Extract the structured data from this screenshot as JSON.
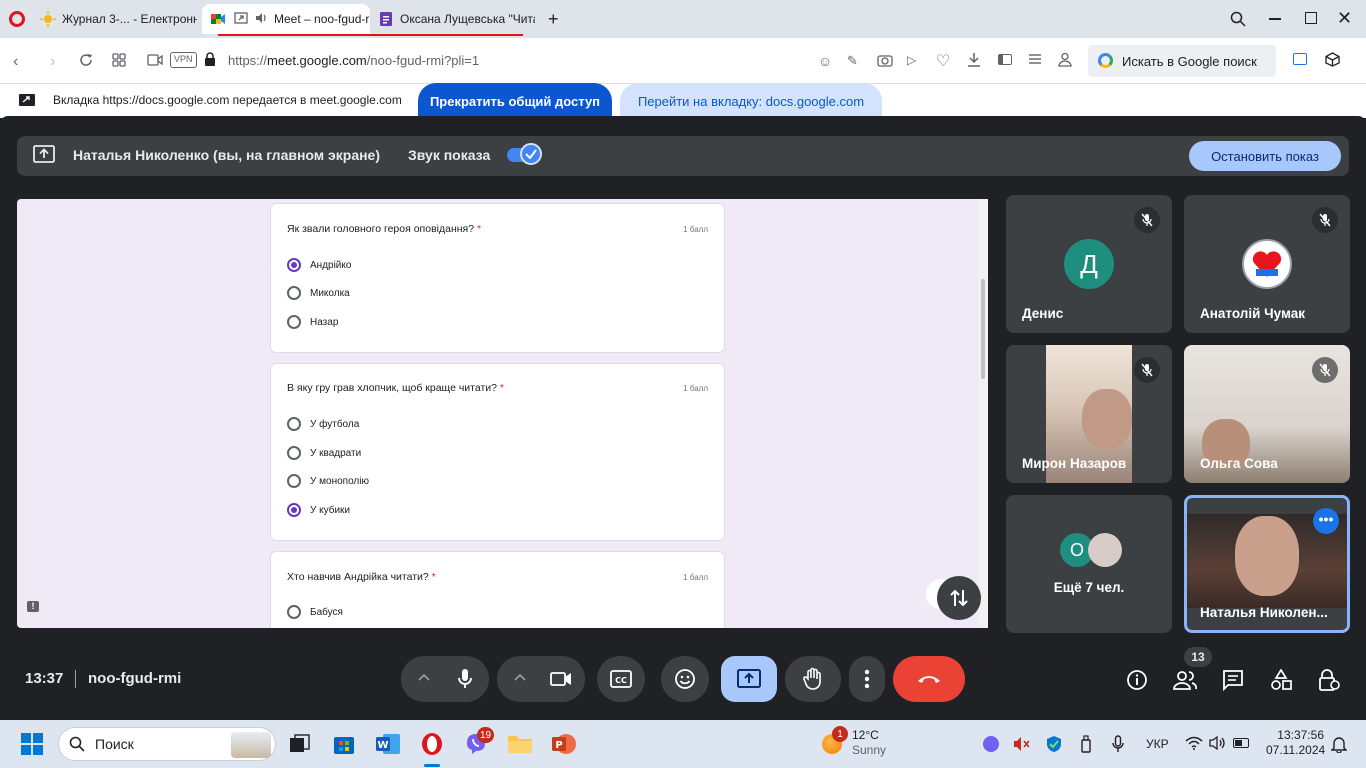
{
  "browser": {
    "tabs": [
      {
        "label": "Журнал 3-... - Електронні",
        "active": false
      },
      {
        "label": "Meet – noo-fgud-r",
        "active": true
      },
      {
        "label": "Оксана Лущевська \"Чита",
        "active": false
      }
    ],
    "url_prefix": "https://",
    "url_domain": "meet.google.com",
    "url_path": "/noo-fgud-rmi?pli=1",
    "vpn_label": "VPN",
    "search_placeholder": "Искать в Google поиск"
  },
  "share_notice": {
    "text": "Вкладка https://docs.google.com передается в meet.google.com",
    "stop_label": "Прекратить общий доступ",
    "goto_label": "Перейти на вкладку: docs.google.com"
  },
  "presenter": {
    "name": "Наталья Николенко (вы, на главном экране)",
    "sound_label": "Звук показа",
    "stop_label": "Остановить показ"
  },
  "form": {
    "questions": [
      {
        "title": "Як звали головного героя оповідання?",
        "required": "*",
        "points": "1 балл",
        "options": [
          {
            "label": "Андрійко",
            "selected": true
          },
          {
            "label": "Миколка",
            "selected": false
          },
          {
            "label": "Назар",
            "selected": false
          }
        ]
      },
      {
        "title": "В яку гру грав хлопчик, щоб краще читати?",
        "required": "*",
        "points": "1 балл",
        "options": [
          {
            "label": "У футбола",
            "selected": false
          },
          {
            "label": "У квадрати",
            "selected": false
          },
          {
            "label": "У монополію",
            "selected": false
          },
          {
            "label": "У кубики",
            "selected": true
          }
        ]
      },
      {
        "title": "Хто навчив Андрійка читати?",
        "required": "*",
        "points": "1 балл",
        "options": [
          {
            "label": "Бабуся",
            "selected": false
          }
        ]
      }
    ]
  },
  "participants": [
    {
      "name": "Денис",
      "initial": "Д",
      "avatar_color": "#1e8e7e",
      "muted": true
    },
    {
      "name": "Анатолій Чумак",
      "initial": "",
      "muted": true
    },
    {
      "name": "Мирон Назаров",
      "muted": true
    },
    {
      "name": "Ольга Сова",
      "muted": true
    },
    {
      "name": "Ещё 7 чел.",
      "initial": "О",
      "avatar_color": "#1e8e7e"
    },
    {
      "name": "Наталья Николен..."
    }
  ],
  "controls": {
    "time": "13:37",
    "meeting_code": "noo-fgud-rmi",
    "people_count": "13"
  },
  "taskbar": {
    "search_label": "Поиск",
    "viber_badge": "19",
    "weather_badge": "1",
    "temperature": "12°C",
    "weather_text": "Sunny",
    "language": "УКР",
    "time": "13:37:56",
    "date": "07.11.2024"
  },
  "colors": {
    "meet_bg": "#202124",
    "tile_bg": "#3c4043",
    "accent_blue": "#0b57d0",
    "end_call_red": "#ea4335",
    "form_purple": "#673ab7"
  }
}
